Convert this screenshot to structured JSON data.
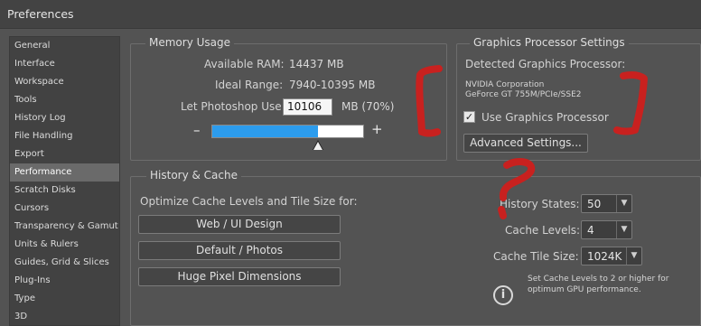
{
  "window": {
    "title": "Preferences"
  },
  "sidebar": {
    "items": [
      {
        "label": "General"
      },
      {
        "label": "Interface"
      },
      {
        "label": "Workspace"
      },
      {
        "label": "Tools"
      },
      {
        "label": "History Log"
      },
      {
        "label": "File Handling"
      },
      {
        "label": "Export"
      },
      {
        "label": "Performance",
        "selected": true
      },
      {
        "label": "Scratch Disks"
      },
      {
        "label": "Cursors"
      },
      {
        "label": "Transparency & Gamut"
      },
      {
        "label": "Units & Rulers"
      },
      {
        "label": "Guides, Grid & Slices"
      },
      {
        "label": "Plug-Ins"
      },
      {
        "label": "Type"
      },
      {
        "label": "3D"
      }
    ]
  },
  "memory": {
    "title": "Memory Usage",
    "available_label": "Available RAM:",
    "available_value": "14437 MB",
    "ideal_label": "Ideal Range:",
    "ideal_value": "7940-10395 MB",
    "let_label": "Let Photoshop Use:",
    "let_value": "10106",
    "let_unit": "MB (70%)",
    "minus": "–",
    "plus": "+",
    "slider_fraction": 0.7
  },
  "gpu": {
    "title": "Graphics Processor Settings",
    "detected_label": "Detected Graphics Processor:",
    "vendor": "NVIDIA Corporation",
    "model": "GeForce GT 755M/PCIe/SSE2",
    "use_label": "Use Graphics Processor",
    "use_checked": true,
    "advanced_button": "Advanced Settings..."
  },
  "history": {
    "title": "History & Cache",
    "optimize_label": "Optimize Cache Levels and Tile Size for:",
    "buttons": [
      "Web / UI Design",
      "Default / Photos",
      "Huge Pixel Dimensions"
    ],
    "history_states_label": "History States:",
    "history_states_value": "50",
    "cache_levels_label": "Cache Levels:",
    "cache_levels_value": "4",
    "tile_size_label": "Cache Tile Size:",
    "tile_size_value": "1024K",
    "note_line1": "Set Cache Levels to 2 or higher for",
    "note_line2": "optimum GPU performance."
  },
  "colors": {
    "accent": "#2c9ced",
    "annotation": "#c8211f",
    "panel": "#535353"
  }
}
